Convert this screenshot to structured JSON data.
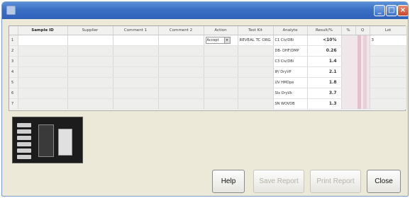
{
  "window": {
    "title": "",
    "controls": [
      "minimize",
      "maximize",
      "close"
    ]
  },
  "table": {
    "columns": [
      "",
      "Sample ID",
      "Supplier",
      "Comment 1",
      "Comment 2",
      "Action",
      "Test Kit",
      "Analyte",
      "Result/%",
      "%",
      "Q",
      "Lot"
    ],
    "rows": [
      {
        "num": "1",
        "action": "Accept",
        "testkit": "REVEAL TC ORG",
        "analyte": "C1 CIv/DBi",
        "result": "<10%",
        "lot": "3"
      },
      {
        "num": "2",
        "analyte": "DB- DHF/DMP",
        "result": "0.26"
      },
      {
        "num": "3",
        "analyte": "C3 CIv/DBi",
        "result": "1.4"
      },
      {
        "num": "4",
        "analyte": "IP/ DryVP",
        "result": "2.1"
      },
      {
        "num": "5",
        "analyte": "UV HMDpe",
        "result": "1.8"
      },
      {
        "num": "6",
        "analyte": "SIx DryVk",
        "result": "3.7"
      },
      {
        "num": "7",
        "analyte": "SN WOVDB",
        "result": "1.3"
      }
    ]
  },
  "buttons": {
    "help": "Help",
    "save_report": "Save Report",
    "print_report": "Print Report",
    "close": "Close"
  }
}
